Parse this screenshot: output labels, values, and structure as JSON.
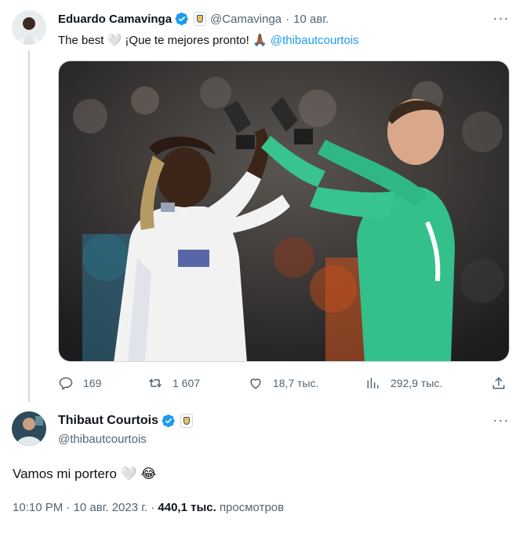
{
  "reply_tweet": {
    "display_name": "Eduardo Camavinga",
    "handle": "@Camavinga",
    "separator": "·",
    "date": "10 авг.",
    "text_prefix": "The best",
    "heart_emoji": "🤍",
    "text_middle": "¡Que te mejores pronto!",
    "pray_emoji": "🙏🏾",
    "mention": "@thibautcourtois",
    "actions": {
      "replies": "169",
      "retweets": "1 607",
      "likes": "18,7 тыс.",
      "views": "292,9 тыс."
    }
  },
  "main_tweet": {
    "display_name": "Thibaut Courtois",
    "handle": "@thibautcourtois",
    "text": "Vamos mi portero",
    "emoji_heart": "🤍",
    "emoji_laugh": "😂",
    "time": "10:10 PM",
    "separator": "·",
    "date": "10 авг. 2023 г.",
    "separator2": "·",
    "views_count": "440,1 тыс.",
    "views_label": "просмотров"
  },
  "icons": {
    "verified_color": "#1d9bf0",
    "muted_color": "#536471",
    "mention_color": "#1d9bf0"
  }
}
